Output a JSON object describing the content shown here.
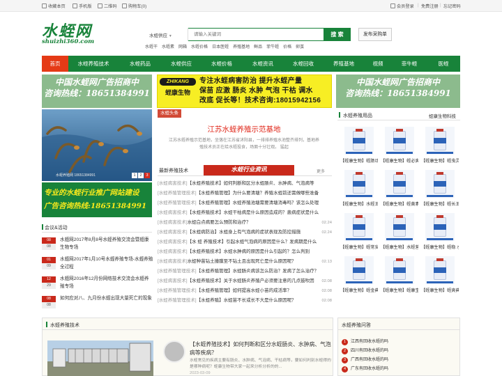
{
  "topbar": {
    "left": [
      "收藏本页",
      "手机版",
      "二维码",
      "购物车(0)"
    ],
    "right": [
      "会员登录",
      "免费注册",
      "忘记密码"
    ]
  },
  "logo": {
    "cn": "水蛭网",
    "en": "shuizhi360.com"
  },
  "search": {
    "category": "水蛭供应",
    "placeholder": "请输入关键词",
    "button": "搜 索",
    "post_button": "发布采购单",
    "hotwords": [
      "水蛭干",
      "水蛭素",
      "网箱",
      "水蛭价格",
      "日本医蛭",
      "养殖基地",
      "鲜品",
      "菲牛蛭",
      "价格",
      "卵茧"
    ]
  },
  "nav": [
    "首页",
    "水蛭养殖技术",
    "水蛭药品",
    "水蛭供应",
    "水蛭价格",
    "水蛭资讯",
    "水蛭回收",
    "养殖基地",
    "视频",
    "菲牛蛭",
    "医蛭"
  ],
  "ads": {
    "left": {
      "line1": "中国水蛭网广告招商中",
      "line2": "咨询热线：18651384991"
    },
    "right": {
      "line1": "中国水蛭网广告招商中",
      "line2": "咨询热线：18651384991"
    },
    "center": {
      "brand_en": "ZHIKANG",
      "brand_cn": "蛭康生物",
      "line1": "专注水蛭病害防治 提升水蛭产量",
      "line2": "保苗 应激 肠炎 水肿 气泡 干枯 调水",
      "line3": "改底 促长等！技术咨询:18015942156"
    },
    "green": {
      "line1": "专业的水蛭行业推广网站建设",
      "line2": "广告咨询热线:18651384991"
    }
  },
  "slideshow": {
    "caption": "水蛭养殖网 18651384991",
    "pages": [
      "1",
      "2",
      "3"
    ],
    "active": "3"
  },
  "toutiao": {
    "tag": "水蛭头条",
    "title": "江苏水蛭养殖示范基地",
    "desc": "江苏水蛭养殖示范基地，坐落在江苏省沭阳县，一排排养殖水池整齐排列，基地养殖技术员正在给水蛭投食，场面十分壮观。 猛起"
  },
  "latest": {
    "title": "最新养殖技术",
    "badge": "水蛭行业资讯",
    "more": "更多",
    "items": [
      {
        "cat": "[水蛭病害技术]",
        "text": "【水蛭养殖技术】如何判断和区分水蛭肠炎、水肿病、气泡病等",
        "date": ""
      },
      {
        "cat": "[水蛭养殖管理技术]",
        "text": "【水蛭养殖管理】为什么要清塘？养殖水蛭前还需做哪些准备",
        "date": ""
      },
      {
        "cat": "[水蛭养殖管理技术]",
        "text": "【水蛭养殖管理】水蛭养殖池塘需要清塘消毒吗？该怎么处理",
        "date": ""
      },
      {
        "cat": "[水蛭病害技术]",
        "text": "【水蛭养殖技术】水蛭干枯病是什么原因造成的？患病症状是什么",
        "date": ""
      },
      {
        "cat": "[水蛭病害技术]",
        "text": "水蛭白点病要怎么预防和治疗？",
        "date": "02.24"
      },
      {
        "cat": "[水蛭病害技术]",
        "text": "【水蛭病防治】水蛭身上有气泡病的症状表现及防控措施",
        "date": "02.24"
      },
      {
        "cat": "[水蛭病害技术]",
        "text": "【水 蛭 养殖技术】引起水蛭气泡病的原因是什么？发病期是什么",
        "date": ""
      },
      {
        "cat": "[水蛭病害技术]",
        "text": "【水蛭养殖技术】水蛭水肿病的原因是什么引起的？怎么判别",
        "date": ""
      },
      {
        "cat": "[水蛭病害技术]",
        "text": "水蛭种苗钻土撞膜至不钻土且出现死亡是什么原因呢？",
        "date": "02.13"
      },
      {
        "cat": "[水蛭养殖管理技术]",
        "text": "【水蛭养殖管理】水蛭肠炎病该怎么防治？发病了怎么治疗？",
        "date": ""
      },
      {
        "cat": "[水蛭病害技术]",
        "text": "【水蛭养殖技术】关于水蛭肠炎养殖户必须要注意的几点鼓吹因",
        "date": "02.08"
      },
      {
        "cat": "[水蛭养殖管理技术]",
        "text": "【水蛭养殖管理】如何提高水蛭小苗的成活率？",
        "date": "02.08"
      },
      {
        "cat": "[水蛭养殖管理技术]",
        "text": "【水蛭养殖】水蛭苗不长或长不大是什么原因呢？",
        "date": "02.08"
      }
    ]
  },
  "meetings": {
    "title": "会议&活动",
    "items": [
      {
        "month": "08",
        "day": "08",
        "text": "水蛭网2017年8月8号水蛭养殖交流会暨蛭康生物专场"
      },
      {
        "month": "01",
        "day": "09",
        "text": "水蛭网2017年1月10号水蛭养殖专场-水蛭养殖全过程"
      },
      {
        "month": "12",
        "day": "29",
        "text": "水蛭网2016年12月份网络技术交流会水蛭养殖专场"
      },
      {
        "month": "08",
        "day": "08",
        "text": "如何应对八、九月份水蛭出现大量死亡的现象"
      }
    ]
  },
  "products": {
    "title": "水蛭养殖用品",
    "subtitle": "蛭康生物科技",
    "items": [
      "【蛭康生物】蛭肠动",
      "【蛭康生物】蛭必爽",
      "【蛭康生物】蛭虫灵 肠胃",
      "【蛭康生物】水蛭王",
      "【蛭康生物】蛭黄素",
      "【蛭康生物】蛭长王",
      "【蛭康生物】蛭常安",
      "【蛭康生物】水蛭营养",
      "【蛭康生物】蛭稳 水体",
      "【蛭康生物】蛭金典 水蛭",
      "【蛭康生物】蛭康宝",
      "【蛭康生物】蛭爽典 水蛭"
    ]
  },
  "tech_section": {
    "title": "水蛭养殖技术",
    "article_title": "【水蛭养殖技术】如何判断和区分水蛭肠炎、水肿病、气泡病等疾病？",
    "article_desc": "水蛭常见的疾病主要有肠炎、水肿病、气泡病、干枯病等，要如何判别水蛭得的是哪种病呢？蛭康生物带大家一起来分析分析的的...",
    "article_date": "2023-03-09"
  },
  "qa_section": {
    "title": "水蛭养殖问答",
    "items": [
      "江西有回收水蛭的吗",
      "四川有回收水蛭的吗",
      "广西有回收水蛭的吗",
      "广东有回收水蛭的吗"
    ]
  },
  "colors": {
    "brand_green": "#18833a",
    "nav_active": "#e53a16",
    "accent_red": "#c9291b",
    "ad_yellow": "#f7ee24"
  }
}
